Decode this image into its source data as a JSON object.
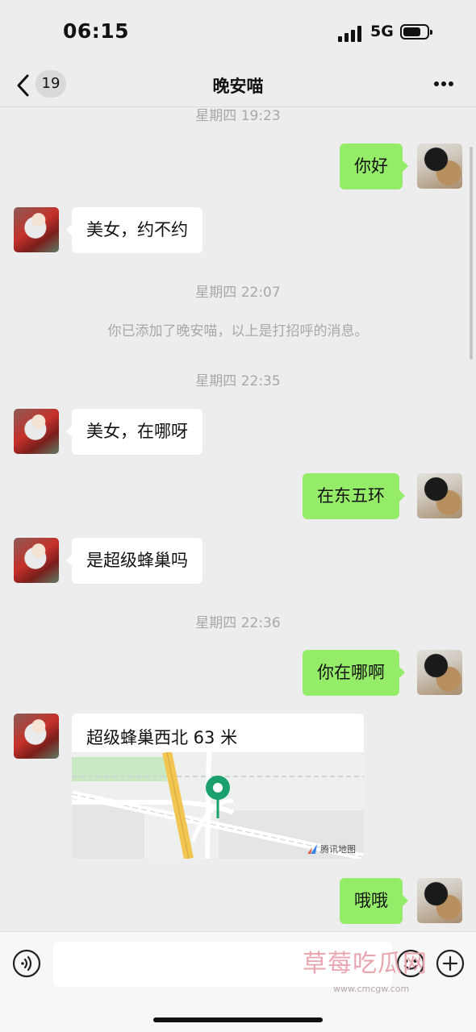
{
  "status_bar": {
    "time": "06:15",
    "network": "5G"
  },
  "nav": {
    "back_badge": "19",
    "title": "晚安喵"
  },
  "messages": {
    "ts1": "星期四 19:23",
    "out1": "你好",
    "in1": "美女，约不约",
    "ts2": "星期四 22:07",
    "system1": "你已添加了晚安喵，以上是打招呼的消息。",
    "ts3": "星期四 22:35",
    "in2": "美女，在哪呀",
    "out2": "在东五环",
    "in3": "是超级蜂巢吗",
    "ts4": "星期四 22:36",
    "out3": "你在哪啊",
    "location_title": "超级蜂巢西北 63 米",
    "map_credit": "腾讯地图",
    "out4": "哦哦"
  },
  "input_bar": {
    "value": "",
    "placeholder": ""
  },
  "watermark": {
    "text": "草莓吃瓜网",
    "url": "www.cmcgw.com"
  },
  "colors": {
    "outgoing_bubble": "#95ec69",
    "incoming_bubble": "#ffffff",
    "background": "#ededed",
    "map_pin": "#1aa06d"
  },
  "icons": [
    "back-chevron-icon",
    "more-dots-icon",
    "voice-icon",
    "emoji-icon",
    "plus-icon",
    "map-pin-icon",
    "signal-icon",
    "battery-icon"
  ]
}
